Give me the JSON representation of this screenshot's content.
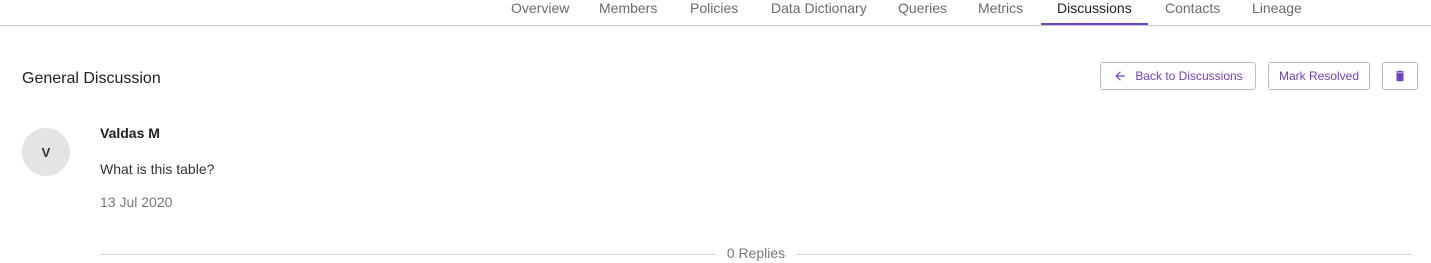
{
  "tabs": [
    {
      "label": "Overview"
    },
    {
      "label": "Members"
    },
    {
      "label": "Policies"
    },
    {
      "label": "Data Dictionary"
    },
    {
      "label": "Queries"
    },
    {
      "label": "Metrics"
    },
    {
      "label": "Discussions",
      "active": true
    },
    {
      "label": "Contacts"
    },
    {
      "label": "Lineage"
    }
  ],
  "discussion": {
    "title": "General Discussion",
    "back_label": "Back to Discussions",
    "resolve_label": "Mark Resolved",
    "back_icon": "arrow-left-icon",
    "delete_icon": "trash-icon"
  },
  "post": {
    "avatar_initial": "V",
    "author": "Valdas M",
    "message": "What is this table?",
    "date": "13 Jul 2020"
  },
  "replies_label": "0 Replies",
  "colors": {
    "accent": "#6f42c1",
    "border": "#c8c8c8",
    "avatar_bg": "#e4e4e4"
  }
}
